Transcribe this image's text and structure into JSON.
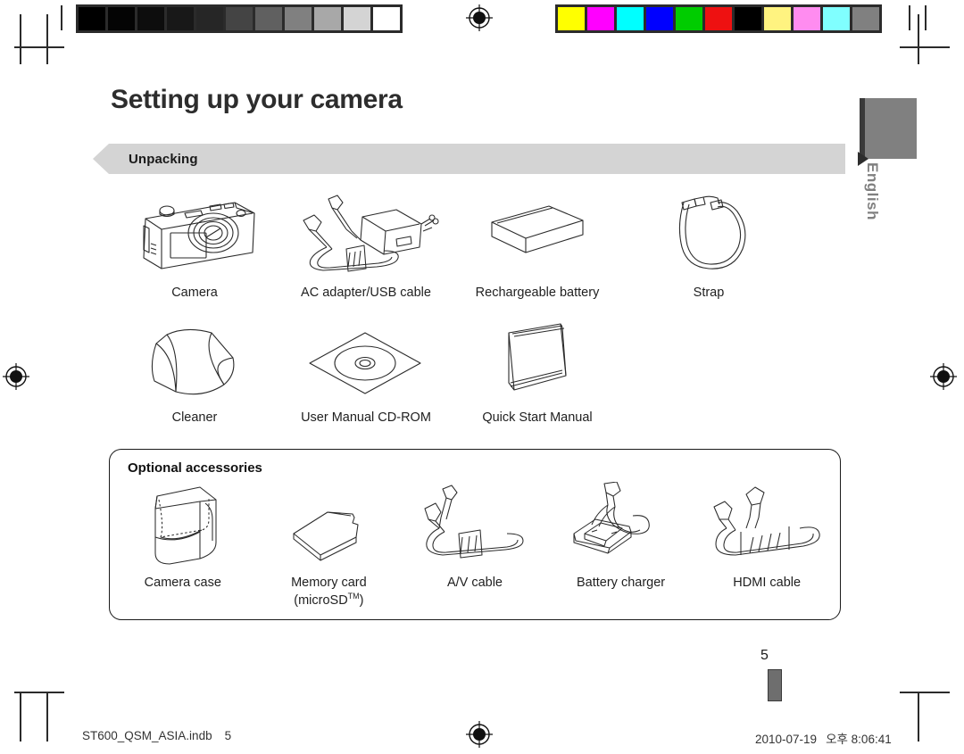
{
  "document": {
    "title": "Setting up your camera",
    "section_label": "Unpacking",
    "optional_title": "Optional accessories",
    "page_number": "5",
    "side_tab_language": "English"
  },
  "colors": {
    "banner_bg": "#d4d4d4",
    "text": "#1f1f1f",
    "tab_gray": "#808080",
    "mark_ink": "#2b2b2b"
  },
  "calibration": {
    "gray_bar": [
      "#000000",
      "#040404",
      "#0d0d0d",
      "#181818",
      "#262626",
      "#444444",
      "#606060",
      "#808080",
      "#a8a8a8",
      "#d4d4d4",
      "#ffffff"
    ],
    "color_bar": [
      "#ffff00",
      "#ff00ff",
      "#00ffff",
      "#0000ff",
      "#00cc00",
      "#ee1111",
      "#000000",
      "#fff380",
      "#ff8cf0",
      "#80ffff",
      "#808080"
    ]
  },
  "unpacking": {
    "row1": [
      {
        "icon": "camera-illustration",
        "label": "Camera"
      },
      {
        "icon": "ac-adapter-usb-cable-illustration",
        "label": "AC adapter/USB cable"
      },
      {
        "icon": "rechargeable-battery-illustration",
        "label": "Rechargeable battery"
      },
      {
        "icon": "strap-illustration",
        "label": "Strap"
      }
    ],
    "row2": [
      {
        "icon": "cleaner-cloth-illustration",
        "label": "Cleaner"
      },
      {
        "icon": "cd-rom-illustration",
        "label": "User Manual CD-ROM"
      },
      {
        "icon": "quick-start-manual-illustration",
        "label": "Quick Start Manual"
      }
    ]
  },
  "optional_accessories": [
    {
      "icon": "camera-case-illustration",
      "label": "Camera case",
      "sublabel": ""
    },
    {
      "icon": "memory-card-illustration",
      "label": "Memory card",
      "sublabel": "(microSD™)"
    },
    {
      "icon": "av-cable-illustration",
      "label": "A/V cable",
      "sublabel": ""
    },
    {
      "icon": "battery-charger-illustration",
      "label": "Battery charger",
      "sublabel": ""
    },
    {
      "icon": "hdmi-cable-illustration",
      "label": "HDMI cable",
      "sublabel": ""
    }
  ],
  "footer": {
    "filename": "ST600_QSM_ASIA.indb",
    "page": "5",
    "date": "2010-07-19",
    "meridiem": "오후",
    "time": "8:06:41"
  }
}
